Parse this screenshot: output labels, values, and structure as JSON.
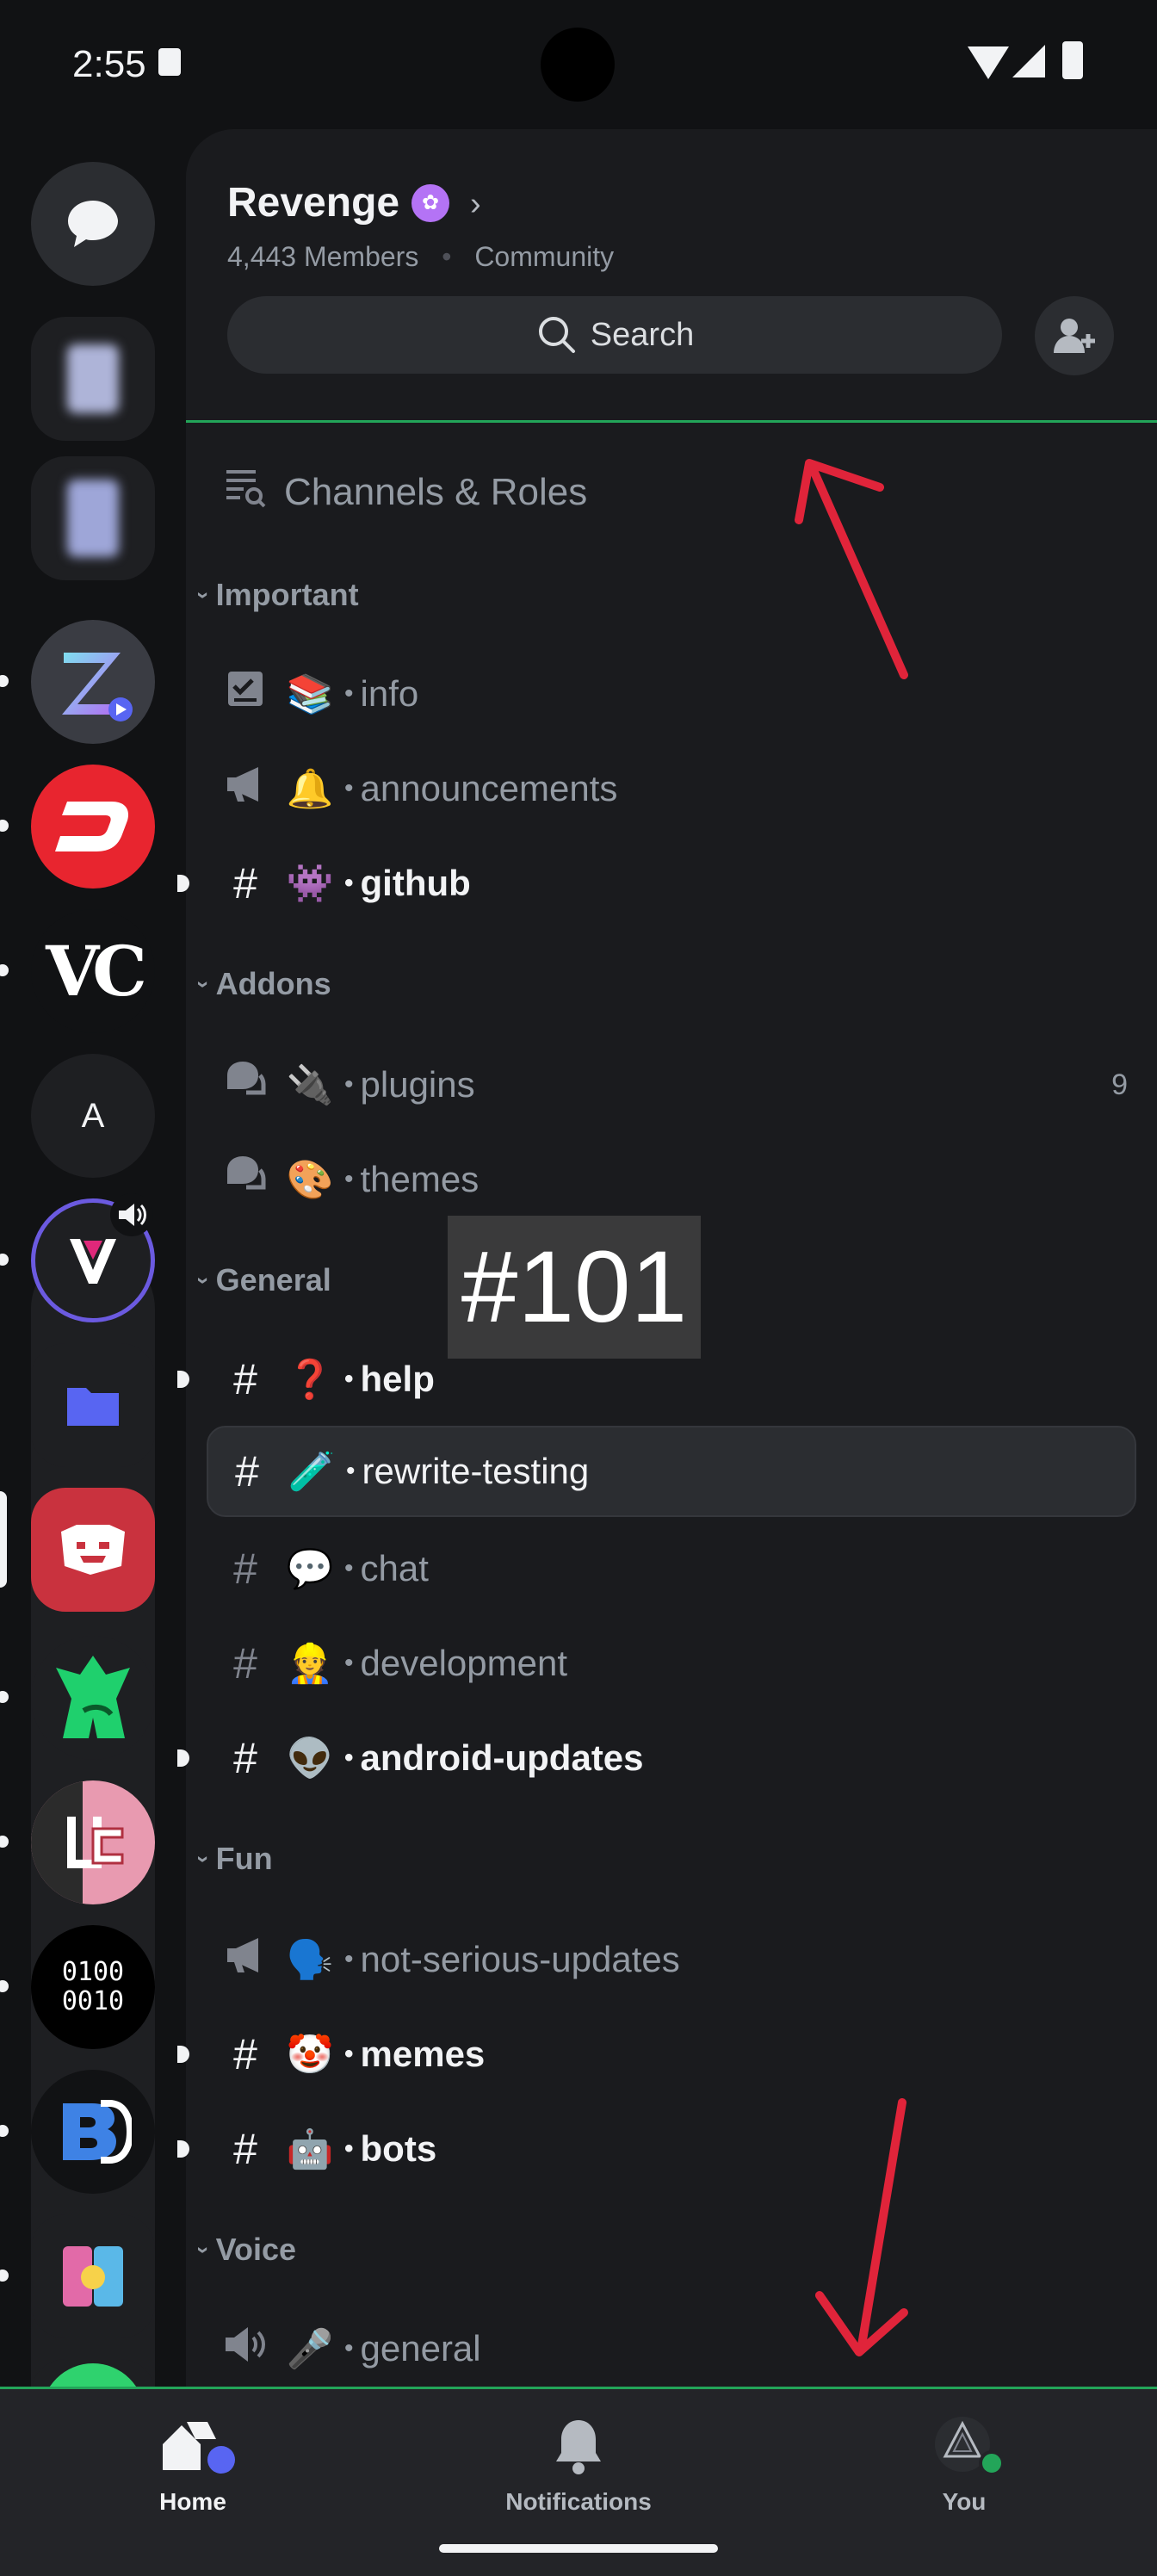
{
  "status_bar": {
    "time": "2:55"
  },
  "server": {
    "name": "Revenge",
    "members": "4,443 Members",
    "community_label": "Community",
    "search_label": "Search"
  },
  "channels_roles_label": "Channels & Roles",
  "categories": {
    "important": "Important",
    "addons": "Addons",
    "general": "General",
    "fun": "Fun",
    "voice": "Voice"
  },
  "channels": {
    "info": {
      "emoji": "📚",
      "name": "info"
    },
    "announcements": {
      "emoji": "🔔",
      "name": "announcements"
    },
    "github": {
      "emoji": "👾",
      "name": "github"
    },
    "plugins": {
      "emoji": "🔌",
      "name": "plugins",
      "count": "9"
    },
    "themes": {
      "emoji": "🎨",
      "name": "themes"
    },
    "help": {
      "emoji": "❓",
      "name": "help"
    },
    "rewrite_testing": {
      "emoji": "🧪",
      "name": "rewrite-testing"
    },
    "chat": {
      "emoji": "💬",
      "name": "chat"
    },
    "development": {
      "emoji": "👷",
      "name": "development"
    },
    "android_updates": {
      "emoji": "👽",
      "name": "android-updates"
    },
    "not_serious_updates": {
      "emoji": "🗣️",
      "name": "not-serious-updates"
    },
    "memes": {
      "emoji": "🤡",
      "name": "memes"
    },
    "bots": {
      "emoji": "🤖",
      "name": "bots"
    },
    "voice_general": {
      "emoji": "🎤",
      "name": "general"
    }
  },
  "guild_rail": {
    "letter_guild": "A",
    "vc_guild": "VC",
    "binary_guild": "0100\n0010"
  },
  "overlay_label": "#101",
  "bottom_nav": {
    "home": "Home",
    "notifications": "Notifications",
    "you": "You"
  },
  "colors": {
    "accent_green": "#23a559",
    "annotation_red": "#e0243a",
    "blurple": "#5865f2"
  }
}
